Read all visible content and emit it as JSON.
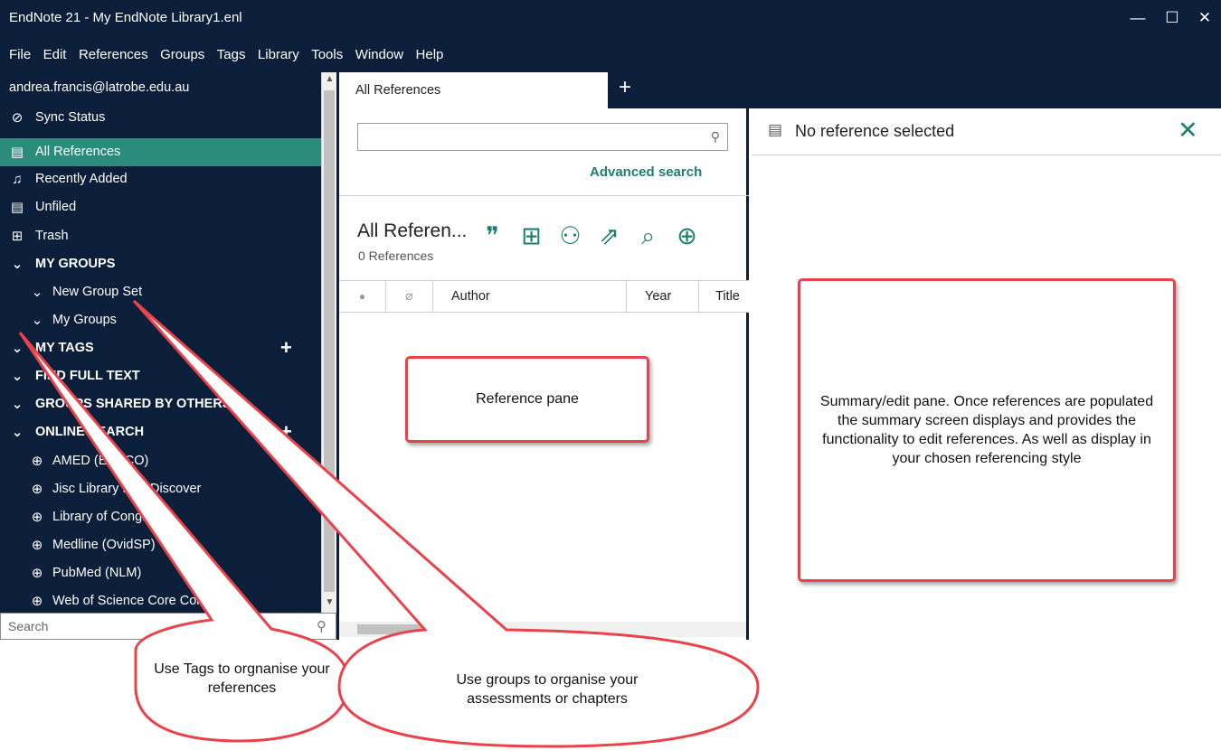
{
  "window": {
    "title": "EndNote 21 - My EndNote Library1.enl",
    "minimize_glyph": "—",
    "maximize_glyph": "☐",
    "close_glyph": "✕"
  },
  "menu": [
    "File",
    "Edit",
    "References",
    "Groups",
    "Tags",
    "Library",
    "Tools",
    "Window",
    "Help"
  ],
  "sidebar": {
    "account": "andrea.francis@latrobe.edu.au",
    "sync_status": "Sync Status",
    "all_references": "All References",
    "recently_added": "Recently Added",
    "unfiled": "Unfiled",
    "trash": "Trash",
    "my_groups": "MY GROUPS",
    "new_group_set": "New Group Set",
    "my_groups_sub": "My Groups",
    "my_tags": "MY TAGS",
    "find_full_text": "FIND FULL TEXT",
    "groups_shared": "GROUPS SHARED BY OTHERS",
    "online_search": "ONLINE SEARCH",
    "online_items": [
      "AMED (EBSCO)",
      "Jisc Library Hub Discover",
      "Library of Congress",
      "Medline (OvidSP)",
      "PubMed (NLM)",
      "Web of Science Core Collection ..."
    ],
    "search_placeholder": "Search"
  },
  "tabs": {
    "active": "All References",
    "add": "+"
  },
  "reference_pane": {
    "advanced_search": "Advanced search",
    "library_title": "All Referen...",
    "count": "0 References",
    "columns": [
      "Author",
      "Year",
      "Title"
    ]
  },
  "summary_pane": {
    "title": "No reference selected"
  },
  "callouts": {
    "reference_pane": "Reference pane",
    "summary": "Summary/edit pane.  Once references are populated the summary screen displays and provides the functionality to edit references.  As well as display in your chosen referencing style",
    "tags_line1": "Use Tags to orgnanise your",
    "tags_line2": "references",
    "groups_line1": "Use groups to organise your",
    "groups_line2": "assessments or chapters"
  },
  "colors": {
    "navy": "#0c1f3a",
    "teal": "#1f7e6e",
    "selection": "#2b8c7c",
    "callout_red": "#e8434b"
  }
}
